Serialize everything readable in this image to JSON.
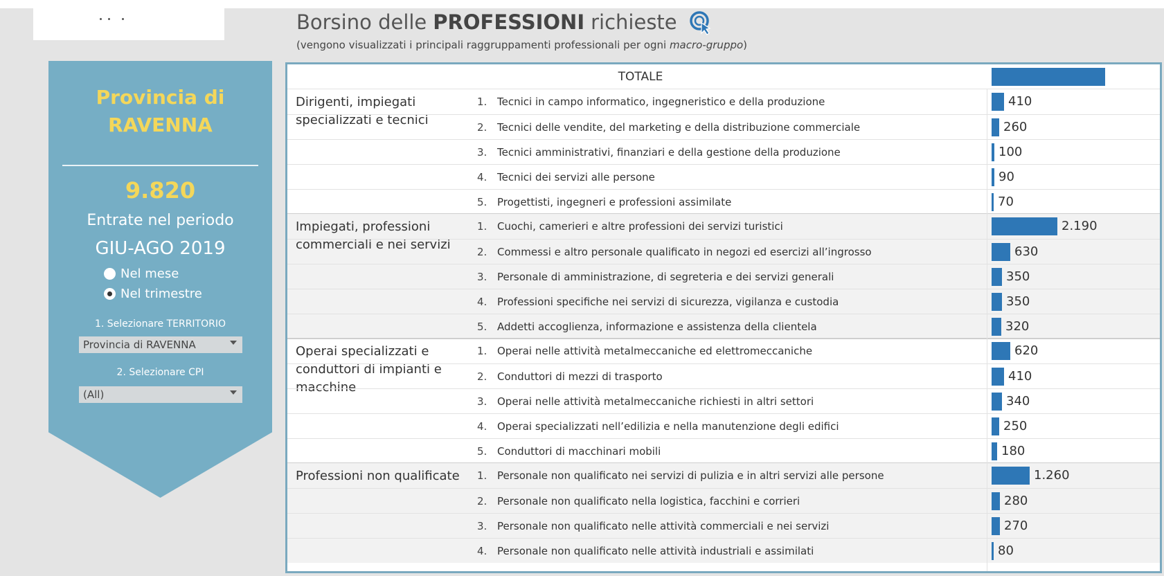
{
  "header": {
    "title_prefix": "Borsino delle",
    "title_bold": "PROFESSIONI",
    "title_suffix": "richieste",
    "subtitle_text": "(vengono visualizzati i principali raggruppamenti professionali per ogni",
    "subtitle_italic": "macro-gruppo",
    "subtitle_close": ")"
  },
  "panel": {
    "prov_line1": "Provincia di",
    "prov_line2": "RAVENNA",
    "total": "9.820",
    "entrate": "Entrate nel periodo",
    "period": "GIU-AGO 2019",
    "radio_month": "Nel mese",
    "radio_quarter": "Nel trimestre",
    "selected_radio": "Nel trimestre",
    "sel_territorio_label": "1. Selezionare TERRITORIO",
    "territorio_value": "Provincia di RAVENNA",
    "sel_cpi_label": "2. Selezionare CPI",
    "cpi_value": "(All)"
  },
  "table": {
    "total_label": "TOTALE",
    "max_value": 2190,
    "groups": [
      {
        "name": "Dirigenti, impiegati specializzati e tecnici",
        "rows": [
          {
            "num": "1.",
            "label": "Tecnici in campo informatico, ingegneristico e della produzione",
            "value": 410,
            "display": "410"
          },
          {
            "num": "2.",
            "label": "Tecnici delle vendite, del marketing e della distribuzione commerciale",
            "value": 260,
            "display": "260"
          },
          {
            "num": "3.",
            "label": "Tecnici amministrativi, finanziari e della gestione della produzione",
            "value": 100,
            "display": "100"
          },
          {
            "num": "4.",
            "label": "Tecnici dei servizi alle persone",
            "value": 90,
            "display": "90"
          },
          {
            "num": "5.",
            "label": "Progettisti, ingegneri e professioni assimilate",
            "value": 70,
            "display": "70"
          }
        ]
      },
      {
        "name": "Impiegati, professioni commerciali e nei servizi",
        "rows": [
          {
            "num": "1.",
            "label": "Cuochi, camerieri e altre professioni dei servizi turistici",
            "value": 2190,
            "display": "2.190"
          },
          {
            "num": "2.",
            "label": "Commessi e altro personale qualificato in negozi ed esercizi all’ingrosso",
            "value": 630,
            "display": "630"
          },
          {
            "num": "3.",
            "label": "Personale di amministrazione, di segreteria e dei servizi generali",
            "value": 350,
            "display": "350"
          },
          {
            "num": "4.",
            "label": "Professioni specifiche nei servizi di sicurezza, vigilanza e custodia",
            "value": 350,
            "display": "350"
          },
          {
            "num": "5.",
            "label": "Addetti accoglienza, informazione e assistenza della clientela",
            "value": 320,
            "display": "320"
          }
        ]
      },
      {
        "name": "Operai specializzati e conduttori di impianti e macchine",
        "rows": [
          {
            "num": "1.",
            "label": "Operai nelle attività metalmeccaniche ed elettromeccaniche",
            "value": 620,
            "display": "620"
          },
          {
            "num": "2.",
            "label": "Conduttori di mezzi di trasporto",
            "value": 410,
            "display": "410"
          },
          {
            "num": "3.",
            "label": "Operai nelle attività metalmeccaniche richiesti in altri settori",
            "value": 340,
            "display": "340"
          },
          {
            "num": "4.",
            "label": "Operai specializzati nell’edilizia e nella manutenzione degli edifici",
            "value": 250,
            "display": "250"
          },
          {
            "num": "5.",
            "label": "Conduttori di macchinari mobili",
            "value": 180,
            "display": "180"
          }
        ]
      },
      {
        "name": "Professioni non qualificate",
        "rows": [
          {
            "num": "1.",
            "label": "Personale non qualificato nei servizi di pulizia e in altri servizi alle persone",
            "value": 1260,
            "display": "1.260"
          },
          {
            "num": "2.",
            "label": "Personale non qualificato nella logistica, facchini e corrieri",
            "value": 280,
            "display": "280"
          },
          {
            "num": "3.",
            "label": "Personale non qualificato nelle attività commerciali e nei servizi",
            "value": 270,
            "display": "270"
          },
          {
            "num": "4.",
            "label": "Personale non qualificato nelle attività industriali e assimilati",
            "value": 80,
            "display": "80"
          }
        ]
      }
    ]
  },
  "colors": {
    "bar": "#2e77b6",
    "panel": "#76aec5",
    "accent_yellow": "#f4d75a",
    "table_border": "#7aa9bf"
  }
}
